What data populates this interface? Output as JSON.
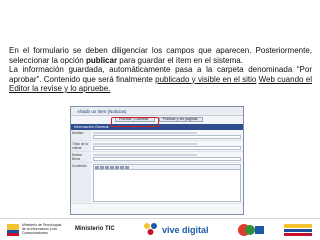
{
  "slide": {
    "paragraph1_part1": "En el formulario se deben diligenciar los campos que aparecen. Posteriormente, seleccionar la opción ",
    "paragraph1_bold": "publicar",
    "paragraph1_part2": " para guardar el ítem en el sistema.",
    "paragraph2_part1": "La información guardada, automáticamente pasa a la carpeta denominada “Por aprobar”. Contenido que será finalmente ",
    "paragraph2_underlined_1": "publicado y visible en el sitio",
    "paragraph2_underlined_2": "Web cuando el Editor la revise y lo apruebe. "
  },
  "screenshot": {
    "window_title": "Añadir un ítem (Noticias)",
    "publish_button": "Publicar | Cancelar",
    "save_button": "Publicar y ver páginas",
    "section_title": "Información General",
    "fields": [
      {
        "label": "Nombre"
      },
      {
        "label": "Título de la noticia"
      },
      {
        "label": "Noticia Breve"
      },
      {
        "label": "Contenido"
      }
    ]
  },
  "footer": {
    "ministry_name": "Ministerio de Tecnologías de la Información y las Comunicaciones",
    "ministerio_tic": "Ministerio TIC",
    "vive_digital": "vive digital"
  },
  "colors": {
    "highlight": "#d0202a",
    "section_bar": "#2f4d8e",
    "vive_digital": "#1b5aa8"
  }
}
